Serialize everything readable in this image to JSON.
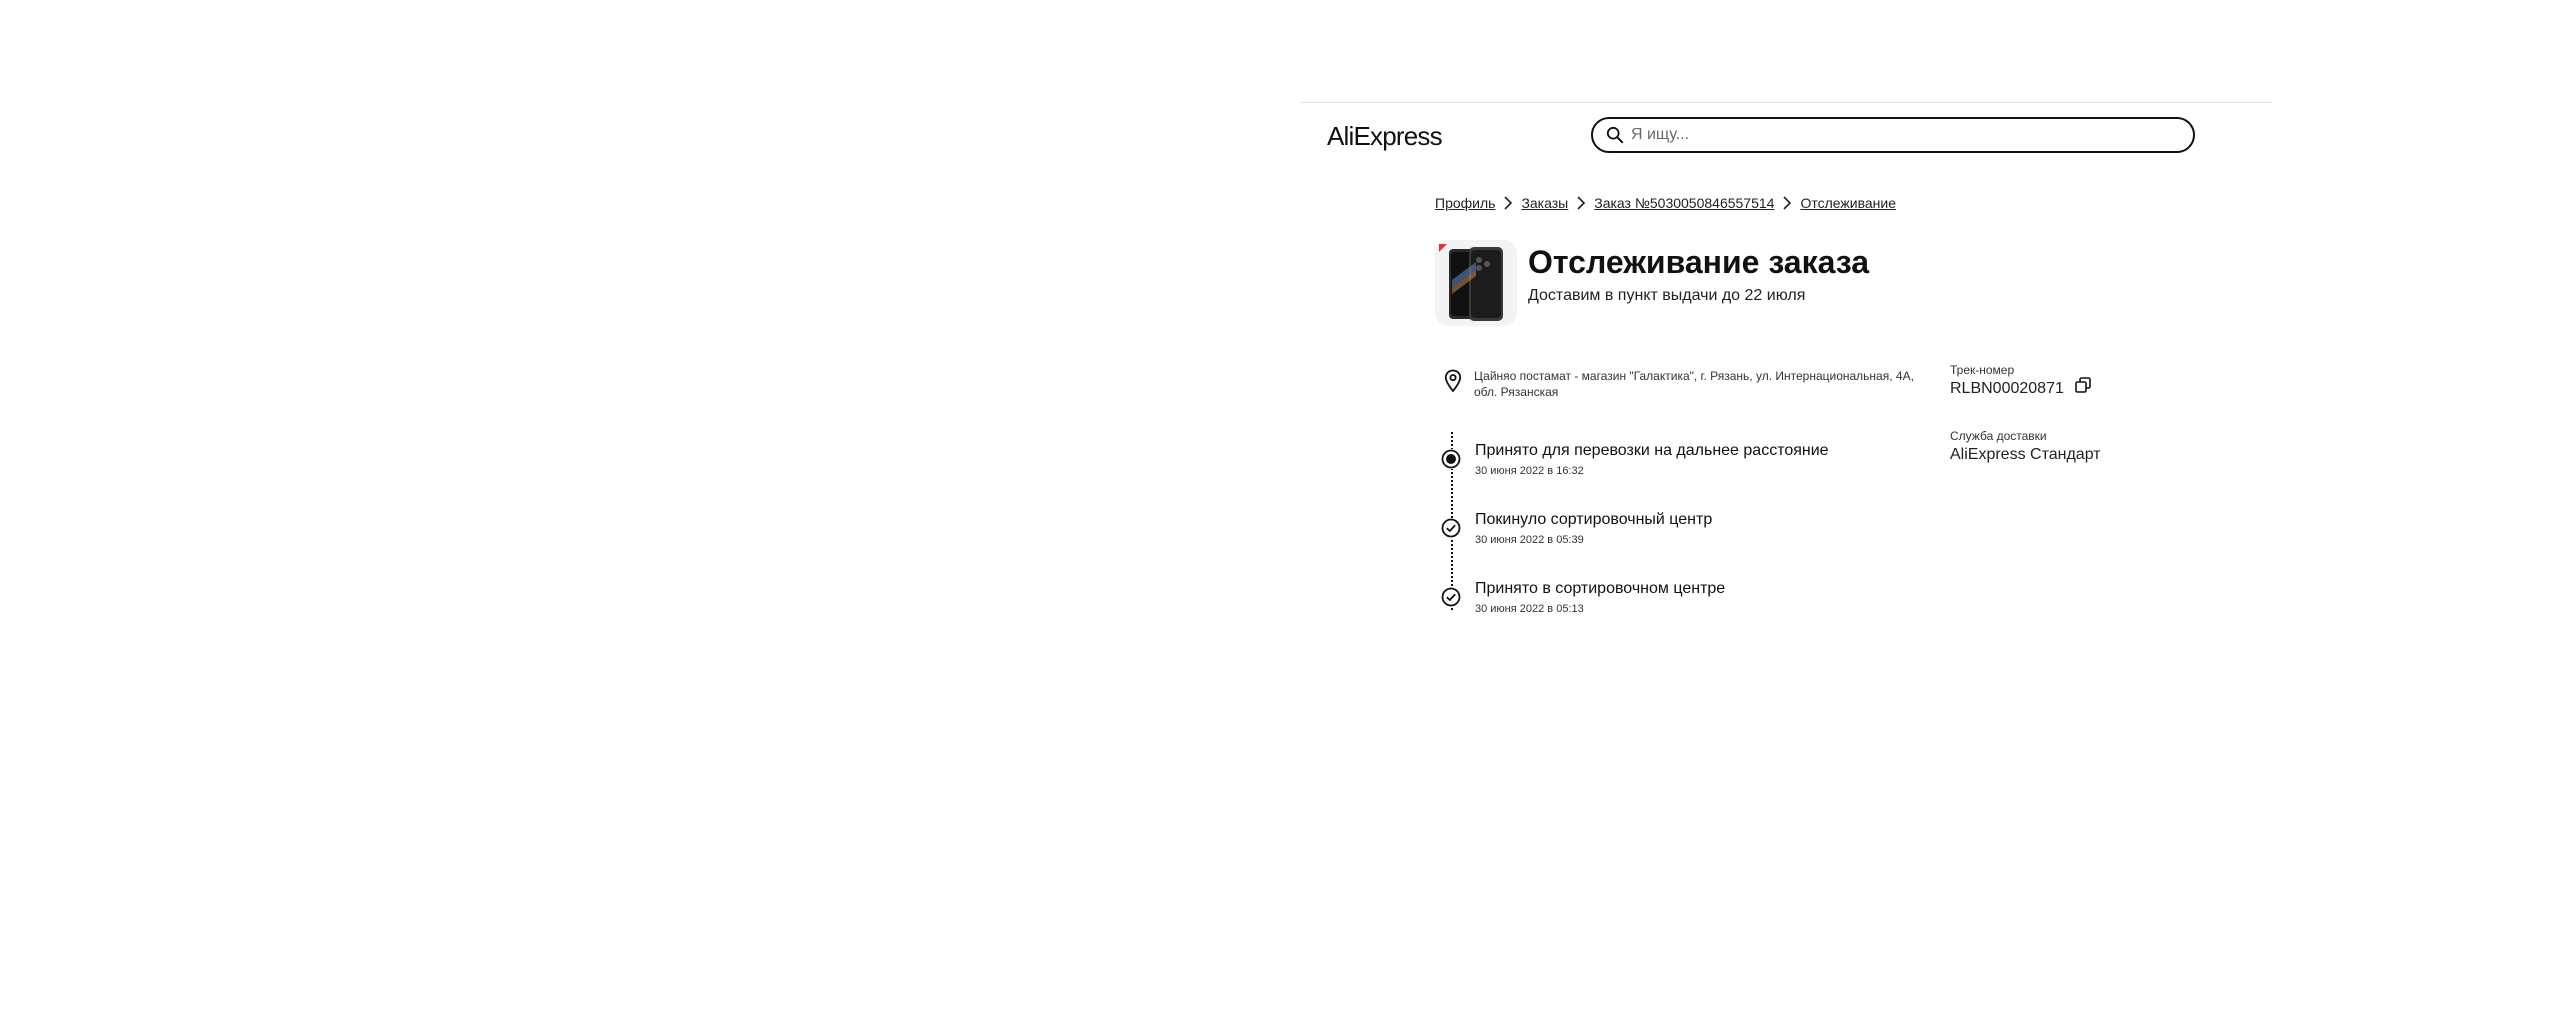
{
  "header": {
    "logo_text": "AliExpress",
    "search": {
      "placeholder": "Я ищу...",
      "value": ""
    }
  },
  "breadcrumb": [
    {
      "label": "Профиль"
    },
    {
      "label": "Заказы"
    },
    {
      "label": "Заказ №5030050846557514"
    },
    {
      "label": "Отслеживание"
    }
  ],
  "order": {
    "title": "Отслеживание заказа",
    "subtitle": "Доставим в пункт выдачи до 22 июля",
    "address": "Цайняо постамат - магазин \"Галактика\", г. Рязань, ул. Интернациональная, 4А, обл. Рязанская"
  },
  "tracking": {
    "events": [
      {
        "title": "Принято для перевозки на дальнее расстояние",
        "date": "30 июня 2022 в 16:32",
        "status": "current"
      },
      {
        "title": "Покинуло сортировочный центр",
        "date": "30 июня 2022 в 05:39",
        "status": "done"
      },
      {
        "title": "Принято в сортировочном центре",
        "date": "30 июня 2022 в 05:13",
        "status": "done"
      }
    ]
  },
  "side_info": {
    "track_label": "Трек-номер",
    "track_number": "RLBN00020871",
    "service_label": "Служба доставки",
    "service_value": "AliExpress Стандарт"
  },
  "colors": {
    "text": "#1a1a1a",
    "border": "#111111",
    "divider": "#e5e5e5",
    "accent_red": "#e62e2e"
  },
  "icons": [
    "search-icon",
    "chevron-right-icon",
    "location-pin-icon",
    "copy-icon",
    "check-circle-icon",
    "active-dot-icon"
  ]
}
